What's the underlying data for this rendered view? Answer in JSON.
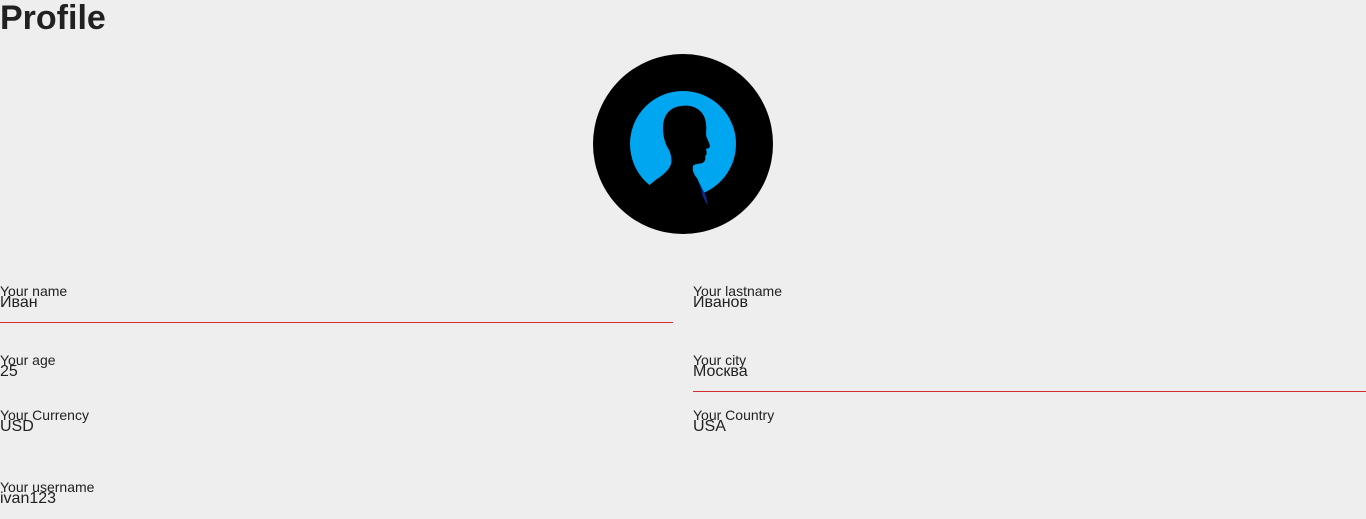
{
  "page": {
    "title": "Profile"
  },
  "colors": {
    "background": "#eeeeee",
    "text": "#212121",
    "focus_underline": "#d32f2f",
    "avatar_bg": "#000000",
    "avatar_circle": "#00a6f0"
  },
  "avatar": {
    "icon": "user-silhouette-icon"
  },
  "fields": {
    "name": {
      "label": "Your name",
      "value": "Иван"
    },
    "lastname": {
      "label": "Your lastname",
      "value": "Иванов"
    },
    "age": {
      "label": "Your age",
      "value": "25"
    },
    "city": {
      "label": "Your city",
      "value": "Москва"
    },
    "currency": {
      "label": "Your Currency",
      "value": "USD"
    },
    "country": {
      "label": "Your Country",
      "value": "USA"
    },
    "username": {
      "label": "Your username",
      "value": "ivan123"
    }
  }
}
